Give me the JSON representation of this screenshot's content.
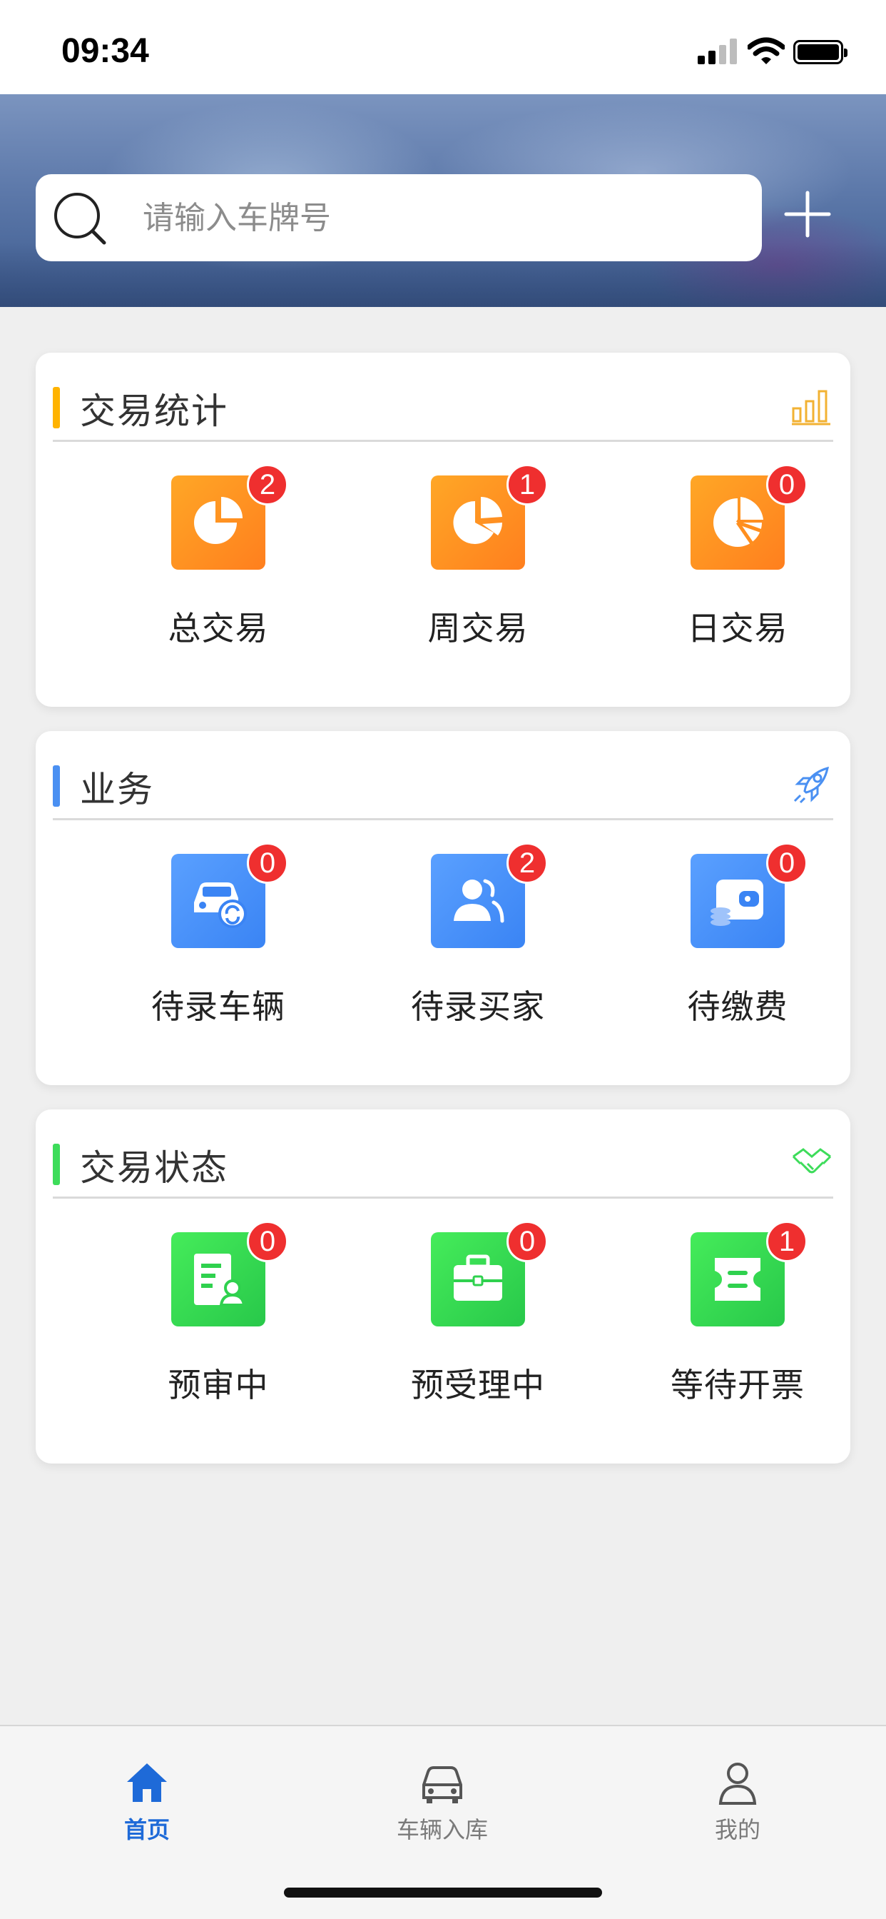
{
  "status_bar": {
    "time": "09:34",
    "icons": [
      "signal-icon",
      "wifi-icon",
      "battery-icon"
    ]
  },
  "header": {
    "search_placeholder": "请输入车牌号",
    "search_value": "",
    "icons": [
      "search-icon",
      "plus-icon"
    ]
  },
  "sections": [
    {
      "title": "交易统计",
      "accent_color": "#ffb300",
      "header_icon": "bar-chart-icon",
      "items": [
        {
          "label": "总交易",
          "badge": "2",
          "icon": "pie-chart-icon"
        },
        {
          "label": "周交易",
          "badge": "1",
          "icon": "pie-chart-icon"
        },
        {
          "label": "日交易",
          "badge": "0",
          "icon": "radial-chart-icon"
        }
      ]
    },
    {
      "title": "业务",
      "accent_color": "#4a90f2",
      "header_icon": "rocket-icon",
      "items": [
        {
          "label": "待录车辆",
          "badge": "0",
          "icon": "car-icon"
        },
        {
          "label": "待录买家",
          "badge": "2",
          "icon": "users-icon"
        },
        {
          "label": "待缴费",
          "badge": "0",
          "icon": "wallet-icon"
        }
      ]
    },
    {
      "title": "交易状态",
      "accent_color": "#3ddc5a",
      "header_icon": "handshake-icon",
      "items": [
        {
          "label": "预审中",
          "badge": "0",
          "icon": "document-user-icon"
        },
        {
          "label": "预受理中",
          "badge": "0",
          "icon": "briefcase-icon"
        },
        {
          "label": "等待开票",
          "badge": "1",
          "icon": "ticket-icon"
        }
      ]
    }
  ],
  "tab_bar": {
    "tabs": [
      {
        "label": "首页",
        "icon": "home-icon",
        "active": true
      },
      {
        "label": "车辆入库",
        "icon": "car-icon",
        "active": false
      },
      {
        "label": "我的",
        "icon": "user-icon",
        "active": false
      }
    ]
  },
  "colors": {
    "orange": "#ff8f1f",
    "blue": "#3a84f4",
    "green": "#2fd14e",
    "badge": "#ef2f2f",
    "tab_active": "#1e6ad8"
  }
}
